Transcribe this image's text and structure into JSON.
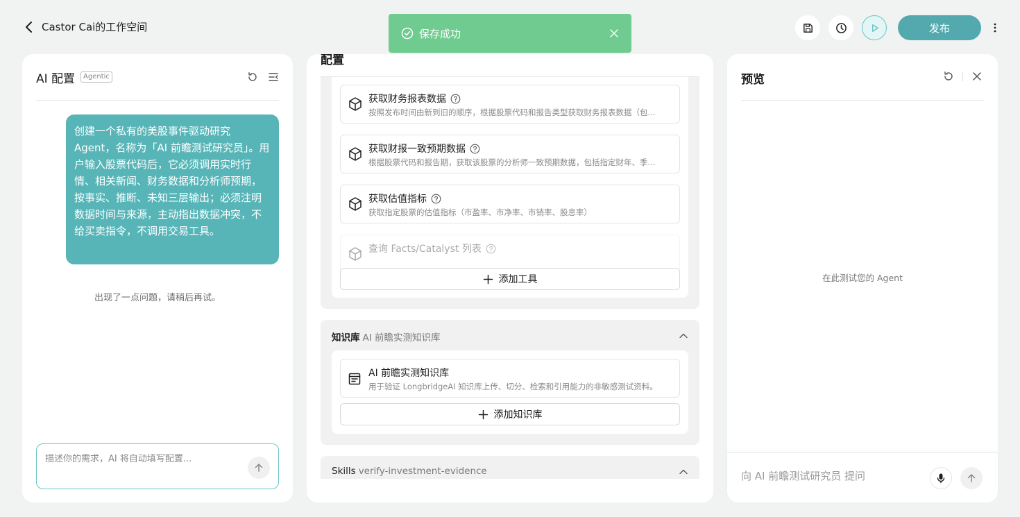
{
  "header": {
    "workspace_title": "Castor Cai的工作空间",
    "publish_label": "发布"
  },
  "toast": {
    "message": "保存成功"
  },
  "left_panel": {
    "title": "AI 配置",
    "badge": "Agentic",
    "user_message": "创建一个私有的美股事件驱动研究 Agent，名称为「AI 前瞻测试研究员」。用户输入股票代码后，它必须调用实时行情、相关新闻、财务数据和分析师预期，按事实、推断、未知三层输出；必须注明数据时间与来源，主动指出数据冲突，不给买卖指令，不调用交易工具。",
    "error_message": "出现了一点问题，请稍后再试。",
    "input_placeholder": "描述你的需求，AI 将自动填写配置..."
  },
  "middle_panel": {
    "title": "配置",
    "tools": [
      {
        "name": "获取财务报表数据",
        "desc": "按照发布时间由新到旧的顺序，根据股票代码和报告类型获取财务报表数据（包..."
      },
      {
        "name": "获取财报一致预期数据",
        "desc": "根据股票代码和报告期，获取该股票的分析师一致预期数据，包括指定财年、季..."
      },
      {
        "name": "获取估值指标",
        "desc": "获取指定股票的估值指标（市盈率、市净率、市销率、股息率）"
      },
      {
        "name": "查询 Facts/Catalyst 列表",
        "desc": ""
      }
    ],
    "add_tool_label": "添加工具",
    "knowledge": {
      "label": "知识库",
      "value": "AI 前瞻实测知识库",
      "item_name": "AI 前瞻实测知识库",
      "item_desc": "用于验证 LongbridgeAI 知识库上传、切分、检索和引用能力的非敏感测试资料。",
      "add_label": "添加知识库"
    },
    "skills": {
      "label": "Skills",
      "value": "verify-investment-evidence"
    }
  },
  "right_panel": {
    "title": "预览",
    "empty_text": "在此测试您的 Agent",
    "input_placeholder": "向 AI 前瞻测试研究员 提问"
  },
  "colors": {
    "accent": "#53a9ad",
    "bubble": "#57b5b8",
    "toast": "#6fcb8f"
  }
}
